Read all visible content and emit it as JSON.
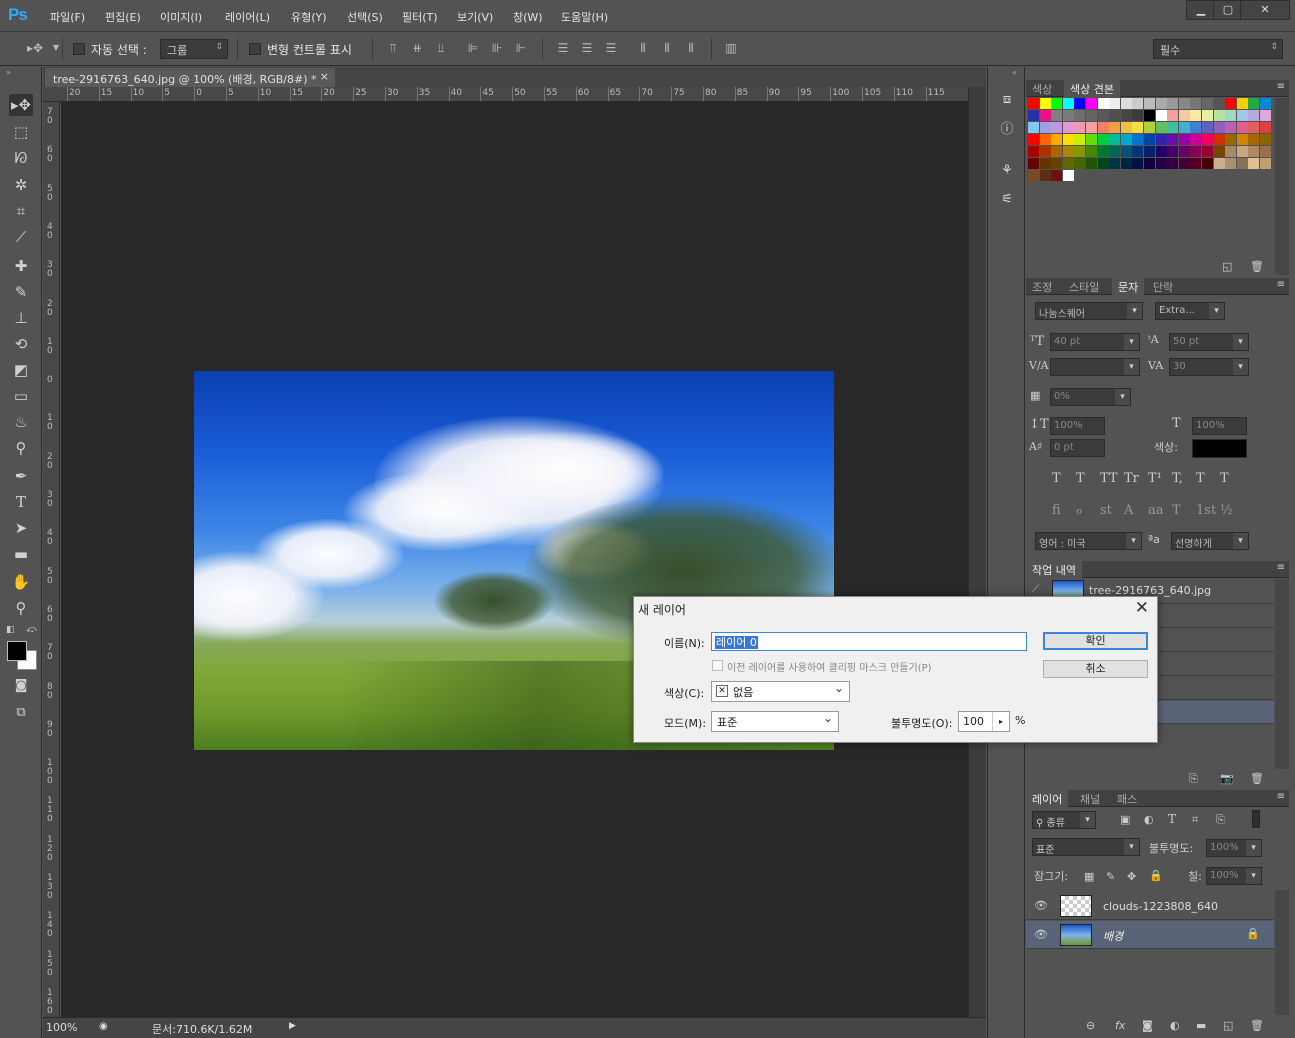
{
  "app": {
    "logo": "Ps",
    "menu": [
      "파일(F)",
      "편집(E)",
      "이미지(I)",
      "레이어(L)",
      "유형(Y)",
      "선택(S)",
      "필터(T)",
      "보기(V)",
      "창(W)",
      "도움말(H)"
    ]
  },
  "options": {
    "auto_select_label": "자동 선택 :",
    "auto_select_value": "그룹",
    "transform_controls_label": "변형 컨트롤 표시",
    "workspace": "필수"
  },
  "document": {
    "tab_title": "tree-2916763_640.jpg @ 100% (배경, RGB/8#) *",
    "tab_close": "×",
    "ruler_h_labels": [
      "20",
      "15",
      "10",
      "5",
      "0",
      "5",
      "10",
      "15",
      "20",
      "25",
      "30",
      "35",
      "40",
      "45",
      "50",
      "55",
      "60",
      "65",
      "70",
      "75",
      "80",
      "85",
      "90",
      "95",
      "100",
      "105",
      "110",
      "115"
    ],
    "ruler_v_labels": [
      "70",
      "60",
      "50",
      "40",
      "30",
      "20",
      "10",
      "0",
      "10",
      "20",
      "30",
      "40",
      "50",
      "60",
      "70",
      "80",
      "90",
      "100",
      "110",
      "120",
      "130",
      "140",
      "150",
      "160"
    ],
    "zoom": "100%",
    "doc_size": "문서:710.6K/1.62M"
  },
  "swatches_panel": {
    "tabs": [
      "색상",
      "색상 견본"
    ],
    "active_tab": "색상 견본",
    "row1": [
      "#ff0000",
      "#ffff00",
      "#00ff00",
      "#00ffff",
      "#0000ff",
      "#ff00ff",
      "#ffffff",
      "#eeeeee",
      "#dddddd",
      "#cccccc",
      "#bbbbbb",
      "#aaaaaa",
      "#999999",
      "#888888",
      "#777777",
      "#666666",
      "#555555",
      "#ff0000",
      "#ffcc00",
      "#22aa44",
      "#0088dd"
    ],
    "row2": [
      "#2233aa",
      "#ee1188",
      "#808080",
      "#7a7a7a",
      "#6e6e6e",
      "#646464",
      "#5a5a5a",
      "#505050",
      "#464646",
      "#3c3c3c",
      "#000000",
      "#ffffff",
      "#f5a09a",
      "#f8c8a0",
      "#fde9a0",
      "#e8f0a0",
      "#b8e0a0",
      "#a0d8c8",
      "#a0c8e8",
      "#b8a8e0",
      "#e0a8d8"
    ],
    "row3": [
      "#80c8f0",
      "#a0a0e0",
      "#c098e0",
      "#e098d8",
      "#f098b8",
      "#f0a0a0",
      "#f08060",
      "#f0a040",
      "#f0c040",
      "#f0e040",
      "#b0d040",
      "#60c060",
      "#40c0a0",
      "#40b0d0",
      "#4080d0",
      "#6060c0",
      "#9060c0",
      "#c060b0",
      "#e06090",
      "#e06060",
      "#e04040"
    ],
    "row4": [
      "#ff0000",
      "#ff6600",
      "#ffaa00",
      "#ffdd00",
      "#ccee00",
      "#66dd00",
      "#00cc44",
      "#00bb99",
      "#00aacc",
      "#0077cc",
      "#0044aa",
      "#3322aa",
      "#6611aa",
      "#9900aa",
      "#cc0099",
      "#ee0066",
      "#cc3300",
      "#996600",
      "#cc8800",
      "#aa6600",
      "#886600"
    ],
    "row5": [
      "#aa0000",
      "#aa3300",
      "#aa6600",
      "#aa8800",
      "#889900",
      "#448800",
      "#007733",
      "#006655",
      "#005577",
      "#003377",
      "#002266",
      "#220066",
      "#440066",
      "#660066",
      "#880055",
      "#990033",
      "#774400",
      "#aa8866",
      "#c8a880",
      "#b08860",
      "#987050"
    ],
    "row6": [
      "#660000",
      "#663300",
      "#664400",
      "#666600",
      "#446600",
      "#225500",
      "#004422",
      "#003344",
      "#002244",
      "#001144",
      "#110044",
      "#220044",
      "#330044",
      "#440033",
      "#550022",
      "#440000",
      "#c8b090",
      "#a89070",
      "#88705a",
      "#e0c090",
      "#c0a070"
    ],
    "row7": [
      "#7a4a20",
      "#5a3010",
      "#701010",
      "#ffffff"
    ]
  },
  "character_panel": {
    "tabs": [
      "조정",
      "스타일",
      "문자",
      "단락"
    ],
    "active_tab": "문자",
    "font_family": "나눔스퀘어",
    "font_style": "Extra...",
    "font_size": "40 pt",
    "leading": "50 pt",
    "kerning": "",
    "tracking": "30",
    "scale_percent": "0%",
    "vertical_scale": "100%",
    "horizontal_scale": "100%",
    "baseline_shift": "0 pt",
    "color_label": "색상:",
    "color_value": "#000000",
    "style_glyphs": [
      "T",
      "T",
      "TT",
      "Tr",
      "T¹",
      "T,",
      "T",
      "T"
    ],
    "opentype_glyphs": [
      "fi",
      "ℴ",
      "st",
      "A",
      "aa",
      "T",
      "1st",
      "½"
    ],
    "language": "영어 : 미국",
    "aa_label": "ªa",
    "antialias": "선명하게"
  },
  "history_panel": {
    "title": "작업 내역",
    "snapshot_name": "tree-2916763_640.jpg"
  },
  "layers_panel": {
    "tabs": [
      "레이어",
      "채널",
      "패스"
    ],
    "active_tab": "레이어",
    "filter_label": "종류",
    "blend_mode": "표준",
    "opacity_label": "불투명도:",
    "opacity_value": "100%",
    "lock_label": "잠그기:",
    "fill_label": "칠:",
    "fill_value": "100%",
    "layers": [
      {
        "name": "clouds-1223808_640",
        "selected": false
      },
      {
        "name": "배경",
        "selected": true
      }
    ]
  },
  "dialog": {
    "title": "새 레이어",
    "close": "✕",
    "name_label": "이름(N):",
    "name_value": "레이어 0",
    "clip_label": "이전 레이어를 사용하여 클리핑 마스크 만들기(P)",
    "color_label": "색상(C):",
    "color_value": "없음",
    "mode_label": "모드(M):",
    "mode_value": "표준",
    "opacity_label": "불투명도(O):",
    "opacity_value": "100",
    "opacity_unit": "%",
    "ok": "확인",
    "cancel": "취소"
  }
}
